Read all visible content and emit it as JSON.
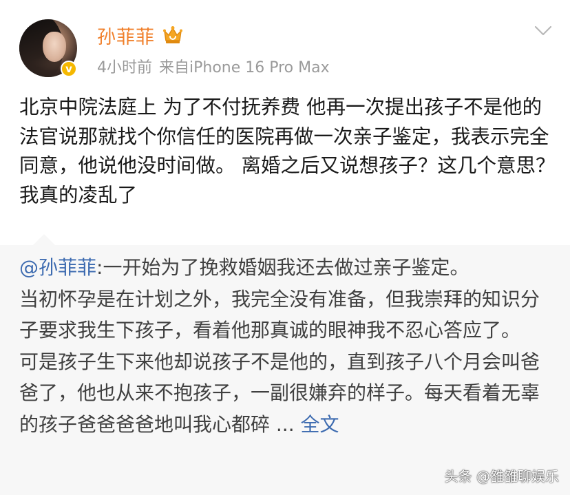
{
  "author": {
    "name": "孙菲菲",
    "avatar_icon": "avatar-photo",
    "verified_badge": "v",
    "member_badge_icon": "crown-icon"
  },
  "meta": {
    "time": "4小时前",
    "source": "来自iPhone 16 Pro Max"
  },
  "post": {
    "text": "北京中院法庭上 为了不付抚养费 他再一次提出孩子不是他的 法官说那就找个你信任的医院再做一次亲子鉴定，我表示完全同意，他说他没时间做。 离婚之后又说想孩子？这几个意思？我真的凌乱了"
  },
  "repost": {
    "mention": "@孙菲菲",
    "line1": ":一开始为了挽救婚姻我还去做过亲子鉴定。",
    "para2": "当初怀孕是在计划之外，我完全没有准备，但我崇拜的知识分子要求我生下孩子，看着他那真诚的眼神我不忍心答应了。",
    "para3": "可是孩子生下来他却说孩子不是他的，直到孩子八个月会叫爸爸了，他也从来不抱孩子，一副很嫌弃的样子。每天看着无辜的孩子爸爸爸爸地叫我心都碎 ...",
    "full_text_link": "全文"
  },
  "watermark": "头条 @雒雒聊娱乐",
  "colors": {
    "username": "#f07f2a",
    "link": "#3d6bb0",
    "meta": "#9a9a9a",
    "repost_bg": "#f7f7f7",
    "verify": "#f5b800"
  }
}
